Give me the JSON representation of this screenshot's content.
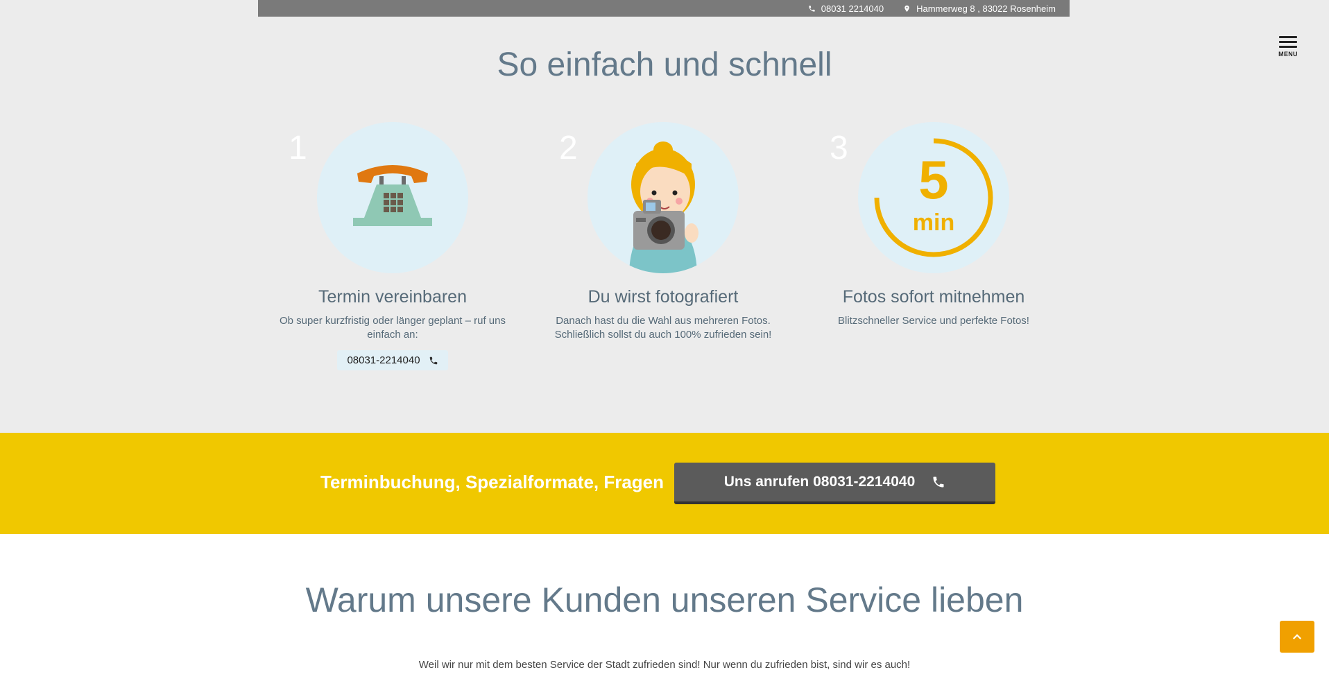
{
  "topbar": {
    "phone": "08031 2214040",
    "address": "Hammerweg 8 , 83022 Rosenheim",
    "phone_icon": "phone-icon",
    "address_icon": "map-pin-icon"
  },
  "menu": {
    "label": "MENU",
    "icon": "hamburger-icon"
  },
  "steps_section": {
    "title": "So einfach und schnell",
    "steps": [
      {
        "number": "1",
        "title": "Termin vereinbaren",
        "text": "Ob super kurzfristig oder länger geplant – ruf uns einfach an:",
        "phone": "08031-2214040",
        "icon": "telephone-illustration"
      },
      {
        "number": "2",
        "title": "Du wirst fotografiert",
        "text": "Danach hast du die Wahl aus mehreren Fotos. Schließlich sollst du auch 100% zufrieden sein!",
        "icon": "photographer-illustration"
      },
      {
        "number": "3",
        "title": "Fotos sofort mitnehmen",
        "text": "Blitzschneller Service und perfekte Fotos!",
        "timer_number": "5",
        "timer_unit": "min",
        "icon": "timer-illustration"
      }
    ]
  },
  "banner": {
    "text": "Terminbuchung, Spezialformate, Fragen",
    "button_label": "Uns anrufen 08031-2214040",
    "button_icon": "phone-icon"
  },
  "why_section": {
    "title": "Warum unsere Kunden unseren Service lieben",
    "subtitle": "Weil wir nur mit dem besten Service der Stadt zufrieden sind! Nur wenn du zufrieden bist, sind wir es auch!"
  },
  "back_to_top": {
    "icon": "chevron-up-icon"
  },
  "colors": {
    "accent_yellow": "#f0c800",
    "timer_orange": "#f0b000",
    "heading_slate": "#63798a",
    "circle_bg": "#dff0f7"
  }
}
